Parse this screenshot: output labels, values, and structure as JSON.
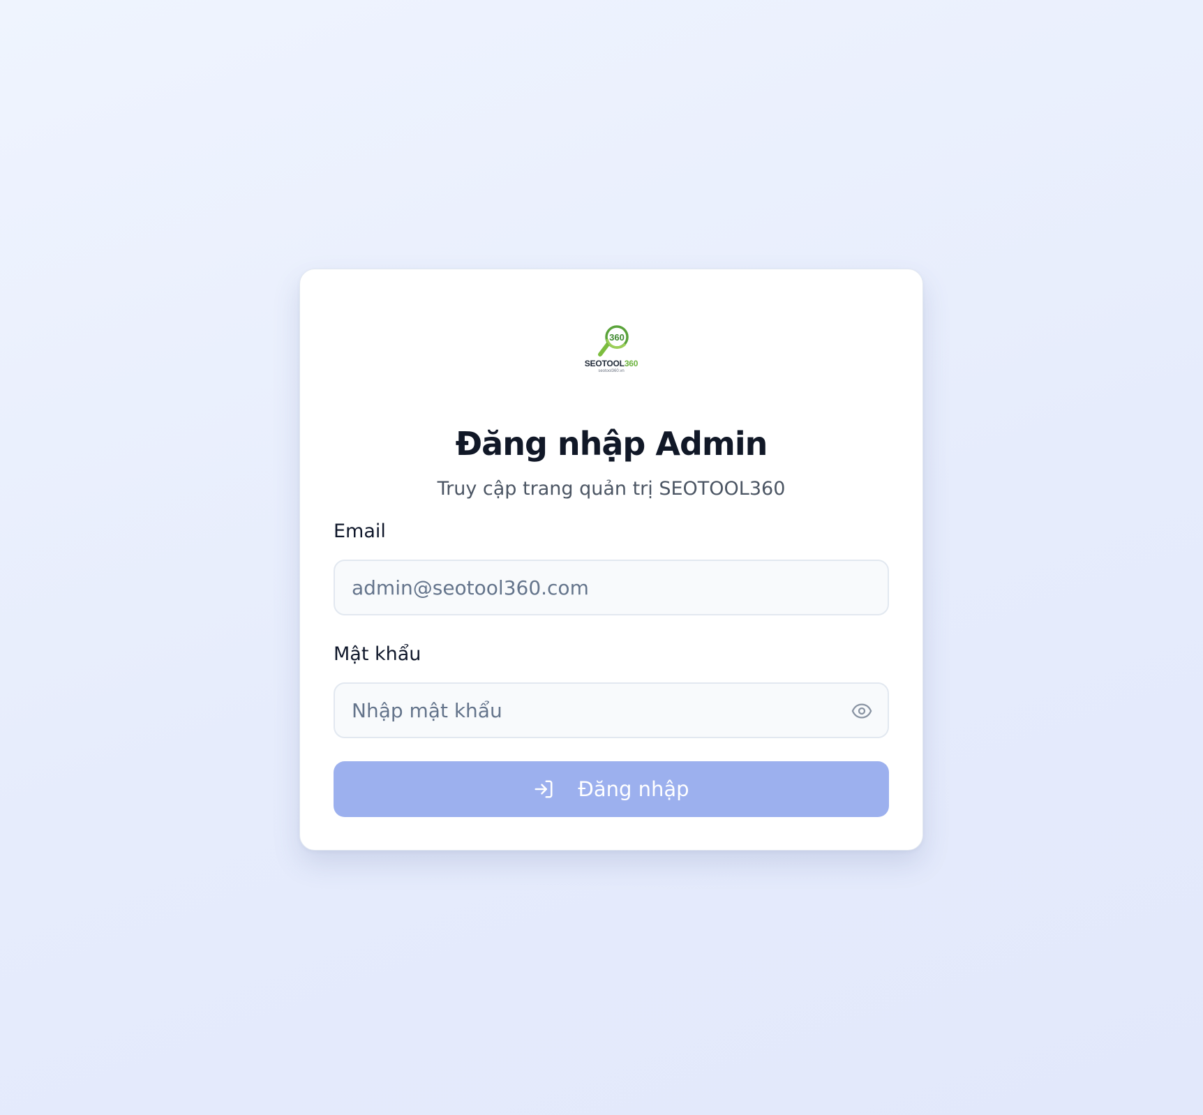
{
  "logo": {
    "badge": "360",
    "wordmark_main": "SEOTOOL",
    "wordmark_accent": "360",
    "domain": "seotool360.vn",
    "icon": "magnifier-360-logo"
  },
  "login": {
    "title": "Đăng nhập Admin",
    "subtitle": "Truy cập trang quản trị SEOTOOL360",
    "email_label": "Email",
    "email_placeholder": "admin@seotool360.com",
    "email_value": "",
    "password_label": "Mật khẩu",
    "password_placeholder": "Nhập mật khẩu",
    "password_value": "",
    "password_toggle_icon": "eye-icon",
    "submit_label": "Đăng nhập",
    "submit_icon": "sign-in-icon"
  },
  "colors": {
    "button": "#9cb0ee",
    "logo_green": "#6db33f",
    "title": "#111827",
    "subtitle": "#4b5563"
  }
}
